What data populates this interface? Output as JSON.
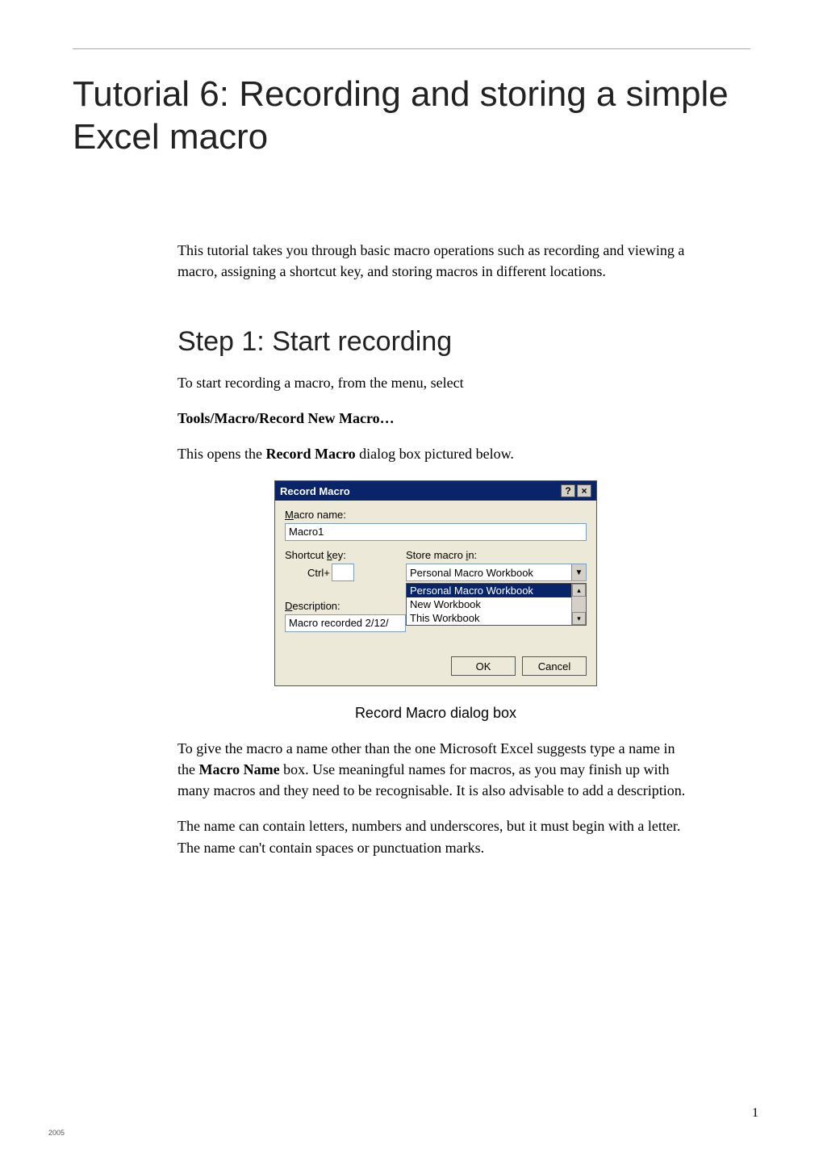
{
  "doc": {
    "title": "Tutorial 6: Recording and storing a simple Excel macro",
    "intro": "This tutorial takes you through basic macro operations such as recording and viewing a macro, assigning a shortcut key, and storing macros in different locations.",
    "step1_heading": "Step 1: Start recording",
    "p1": "To start recording a macro, from the menu, select",
    "p2": "Tools/Macro/Record New Macro…",
    "p3_pre": "This opens the ",
    "p3_bold": "Record Macro",
    "p3_post": " dialog box pictured below.",
    "caption": "Record Macro dialog box",
    "p4_pre": "To give the macro a name other than the one Microsoft Excel suggests type a name in the ",
    "p4_bold": "Macro Name",
    "p4_post": " box. Use meaningful names for macros, as you may finish up with many macros and they need to be recognisable. It is also advisable to add a description.",
    "p5": "The name can contain letters, numbers and underscores, but it must begin with a letter. The name can't contain spaces or punctuation marks."
  },
  "dialog": {
    "title": "Record Macro",
    "help_glyph": "?",
    "close_glyph": "×",
    "macro_name_label_pre": "M",
    "macro_name_label_post": "acro name:",
    "macro_name_value": "Macro1",
    "shortcut_label_pre": "Shortcut ",
    "shortcut_label_ul": "k",
    "shortcut_label_post": "ey:",
    "shortcut_prefix": "Ctrl+",
    "shortcut_value": "",
    "store_label_pre": "Store macro ",
    "store_label_ul": "i",
    "store_label_post": "n:",
    "store_value": "Personal Macro Workbook",
    "store_options": {
      "opt0": "Personal Macro Workbook",
      "opt1": "New Workbook",
      "opt2": "This Workbook"
    },
    "desc_label_ul": "D",
    "desc_label_post": "escription:",
    "desc_value": "Macro recorded 2/12/",
    "ok_label": "OK",
    "cancel_label": "Cancel",
    "arrow_down": "▼",
    "arrow_up_small": "▴",
    "arrow_down_small": "▾"
  },
  "footer": {
    "year": "2005",
    "page": "1"
  }
}
